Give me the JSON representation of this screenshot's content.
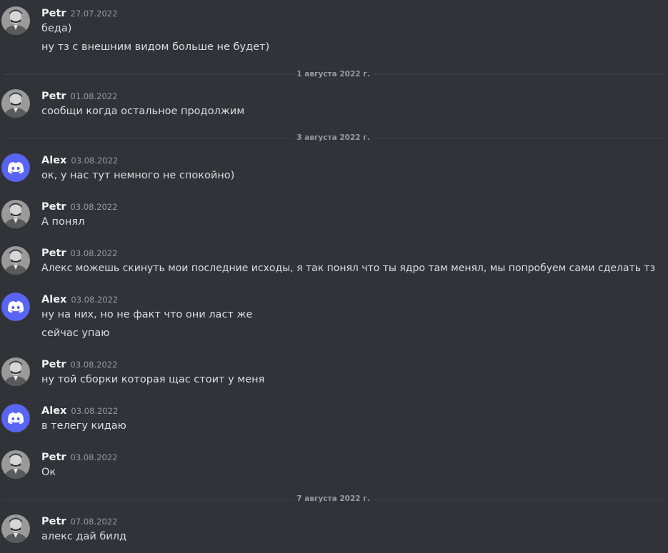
{
  "colors": {
    "background": "#313338",
    "author": "#f2f3f5",
    "text": "#dbdee1",
    "muted": "#949ba4",
    "discord_blurple": "#5865f2"
  },
  "icons": {
    "petr_avatar": "user-photo-avatar",
    "alex_avatar": "discord-logo-avatar"
  },
  "dividers": [
    "1 августа 2022 г.",
    "3 августа 2022 г.",
    "7 августа 2022 г."
  ],
  "messages": [
    {
      "author": "Petr",
      "time": "27.07.2022",
      "lines": [
        "беда)",
        "ну тз с внешним видом больше не будет)"
      ]
    },
    {
      "author": "Petr",
      "time": "01.08.2022",
      "lines": [
        "сообщи когда остальное продолжим"
      ]
    },
    {
      "author": "Alex",
      "time": "03.08.2022",
      "lines": [
        "ок, у нас тут немного не спокойно)"
      ]
    },
    {
      "author": "Petr",
      "time": "03.08.2022",
      "lines": [
        "А понял"
      ]
    },
    {
      "author": "Petr",
      "time": "03.08.2022",
      "lines": [
        "Алекс можешь скинуть мои последние исходы, я так понял что ты ядро там менял, мы попробуем сами сделать тз"
      ]
    },
    {
      "author": "Alex",
      "time": "03.08.2022",
      "lines": [
        "ну на них, но не факт что они ласт же",
        "сейчас упаю"
      ]
    },
    {
      "author": "Petr",
      "time": "03.08.2022",
      "lines": [
        "ну той сборки которая щас стоит у меня"
      ]
    },
    {
      "author": "Alex",
      "time": "03.08.2022",
      "lines": [
        "в телегу кидаю"
      ]
    },
    {
      "author": "Petr",
      "time": "03.08.2022",
      "lines": [
        "Ок"
      ]
    },
    {
      "author": "Petr",
      "time": "07.08.2022",
      "lines": [
        "алекс дай билд"
      ]
    }
  ]
}
